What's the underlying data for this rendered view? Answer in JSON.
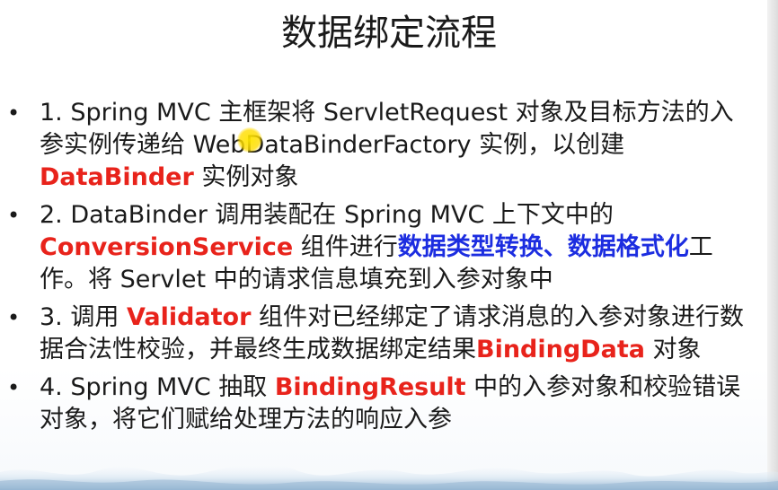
{
  "slide": {
    "title": "数据绑定流程",
    "bullet_marker": "•",
    "bullets": [
      {
        "segments": [
          {
            "text": "1. Spring MVC 主框架将 ServletRequest  对象及目标方法的入参实例传递给 WebDataBinderFactory 实例，以创建 ",
            "style": "normal"
          },
          {
            "text": "DataBinder",
            "style": "red"
          },
          {
            "text": " 实例对象",
            "style": "normal"
          }
        ]
      },
      {
        "segments": [
          {
            "text": "2. DataBinder 调用装配在 Spring MVC 上下文中的 ",
            "style": "normal"
          },
          {
            "text": "ConversionService",
            "style": "red"
          },
          {
            "text": " 组件进行",
            "style": "normal"
          },
          {
            "text": "数据类型转换、数据格式化",
            "style": "blue"
          },
          {
            "text": "工作。将 Servlet 中的请求信息填充到入参对象中",
            "style": "normal"
          }
        ]
      },
      {
        "segments": [
          {
            "text": "3. 调用 ",
            "style": "normal"
          },
          {
            "text": "Validator",
            "style": "red"
          },
          {
            "text": " 组件对已经绑定了请求消息的入参对象进行数据合法性校验，并最终生成数据绑定结果",
            "style": "normal"
          },
          {
            "text": "BindingData",
            "style": "red"
          },
          {
            "text": " 对象",
            "style": "normal"
          }
        ]
      },
      {
        "segments": [
          {
            "text": "4. Spring MVC 抽取 ",
            "style": "normal"
          },
          {
            "text": "BindingResult",
            "style": "red"
          },
          {
            "text": " 中的入参对象和校验错误对象，将它们赋给处理方法的响应入参",
            "style": "normal"
          }
        ]
      }
    ]
  },
  "colors": {
    "text": "#1a1a1a",
    "emphasis_red": "#e8231b",
    "emphasis_blue": "#1c2de0",
    "cursor_highlight": "#ffe000"
  }
}
